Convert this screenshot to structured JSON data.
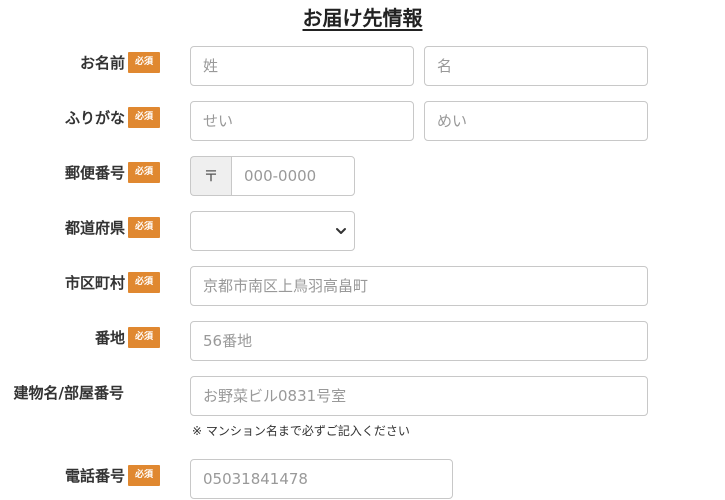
{
  "section_title": "お届け先情報",
  "required_badge": "必須",
  "rows": {
    "name": {
      "label": "お名前",
      "last_placeholder": "姓",
      "first_placeholder": "名"
    },
    "kana": {
      "label": "ふりがな",
      "last_placeholder": "せい",
      "first_placeholder": "めい"
    },
    "postal": {
      "label": "郵便番号",
      "prefix": "〒",
      "placeholder": "000-0000"
    },
    "prefecture": {
      "label": "都道府県",
      "value": ""
    },
    "city": {
      "label": "市区町村",
      "placeholder": "京都市南区上鳥羽高畠町"
    },
    "address": {
      "label": "番地",
      "placeholder": "56番地"
    },
    "building": {
      "label": "建物名/部屋番号",
      "placeholder": "お野菜ビル0831号室",
      "note": "※ マンション名まで必ずご記入ください"
    },
    "phone": {
      "label": "電話番号",
      "placeholder": "05031841478"
    }
  },
  "icons": {
    "select_arrow": "chevron-down-icon"
  }
}
